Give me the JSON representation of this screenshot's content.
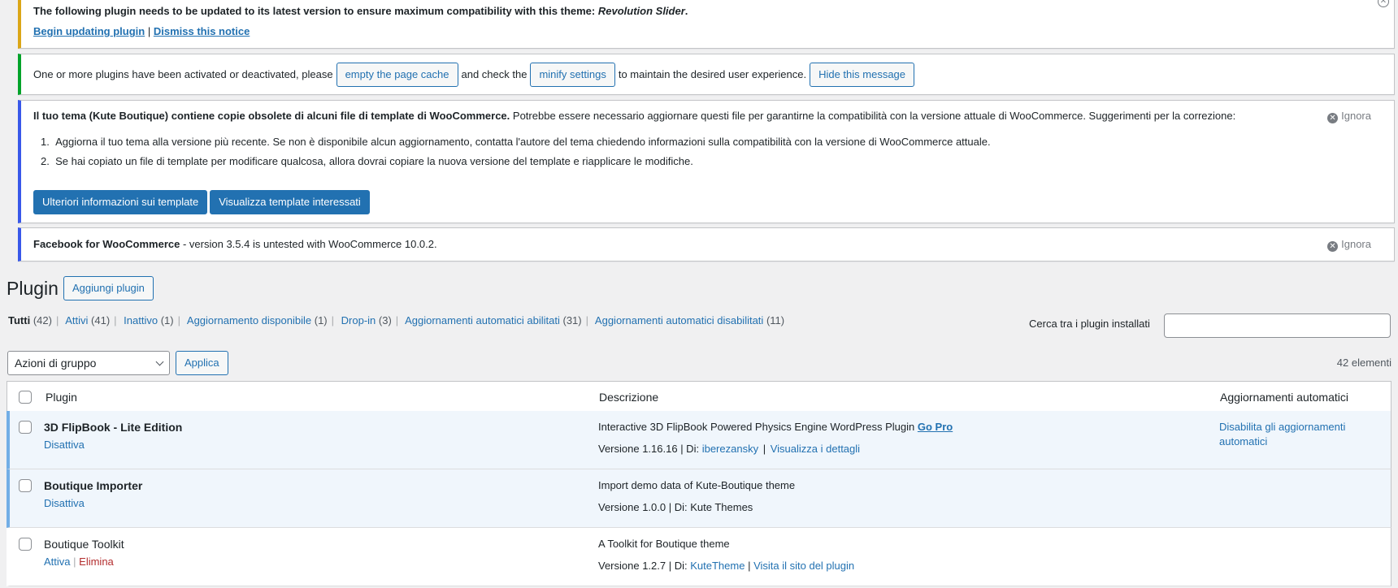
{
  "notices": {
    "plugin_update": {
      "text": "The following plugin needs to be updated to its latest version to ensure maximum compatibility with this theme:",
      "plugin": "Revolution Slider",
      "period": ".",
      "begin_link": "Begin updating plugin",
      "separator": "|",
      "dismiss_link": "Dismiss this notice"
    },
    "cache": {
      "text1": "One or more plugins have been activated or deactivated, please",
      "btn_cache": "empty the page cache",
      "text2": "and check the",
      "btn_minify": "minify settings",
      "text3": "to maintain the desired user experience.",
      "btn_hide": "Hide this message"
    },
    "woo_templates": {
      "bold": "Il tuo tema (Kute Boutique) contiene copie obsolete di alcuni file di template di WooCommerce.",
      "rest": "Potrebbe essere necessario aggiornare questi file per garantirne la compatibilità con la versione attuale di WooCommerce. Suggerimenti per la correzione:",
      "dismiss": "Ignora",
      "items": [
        "Aggiorna il tuo tema alla versione più recente. Se non è disponibile alcun aggiornamento, contatta l'autore del tema chiedendo informazioni sulla compatibilità con la versione di WooCommerce attuale.",
        "Se hai copiato un file di template per modificare qualcosa, allora dovrai copiare la nuova versione del template e riapplicare le modifiche."
      ],
      "btn_info": "Ulteriori informazioni sui template",
      "btn_view": "Visualizza template interessati"
    },
    "facebook": {
      "bold": "Facebook for WooCommerce",
      "rest": "- version 3.5.4 is untested with WooCommerce 10.0.2.",
      "dismiss": "Ignora"
    }
  },
  "page": {
    "title": "Plugin",
    "add_button": "Aggiungi plugin"
  },
  "filters": [
    {
      "label": "Tutti",
      "count": "(42)",
      "current": true
    },
    {
      "label": "Attivi",
      "count": "(41)"
    },
    {
      "label": "Inattivo",
      "count": "(1)"
    },
    {
      "label": "Aggiornamento disponibile",
      "count": "(1)"
    },
    {
      "label": "Drop-in",
      "count": "(3)"
    },
    {
      "label": "Aggiornamenti automatici abilitati",
      "count": "(31)"
    },
    {
      "label": "Aggiornamenti automatici disabilitati",
      "count": "(11)"
    }
  ],
  "search": {
    "label": "Cerca tra i plugin installati",
    "value": ""
  },
  "bulk": {
    "selected": "Azioni di gruppo",
    "apply": "Applica",
    "items_count": "42 elementi"
  },
  "table": {
    "headers": {
      "plugin": "Plugin",
      "description": "Descrizione",
      "auto_updates": "Aggiornamenti automatici"
    },
    "rows": [
      {
        "name": "3D FlipBook - Lite Edition",
        "action1": "Disattiva",
        "description": "Interactive 3D FlipBook Powered Physics Engine WordPress Plugin",
        "desc_link": "Go Pro",
        "version": "Versione 1.16.16 | Di:",
        "author": "iberezansky",
        "details": "Visualizza i dettagli",
        "auto": "Disabilita gli aggiornamenti automatici"
      },
      {
        "name": "Boutique Importer",
        "action1": "Disattiva",
        "description": "Import demo data of Kute-Boutique theme",
        "version": "Versione 1.0.0 | Di: Kute Themes"
      },
      {
        "name": "Boutique Toolkit",
        "action1": "Attiva",
        "action2": "Elimina",
        "description": "A Toolkit for Boutique theme",
        "version": "Versione 1.2.7 | Di:",
        "author": "KuteTheme",
        "details": "Visita il sito del plugin"
      }
    ]
  },
  "colors": {
    "link": "#2271b1",
    "warning_border": "#dba617",
    "success_border": "#00a32a",
    "info_border": "#3858e9",
    "active_row_bg": "#f0f6fc",
    "delete": "#b32d2e"
  }
}
